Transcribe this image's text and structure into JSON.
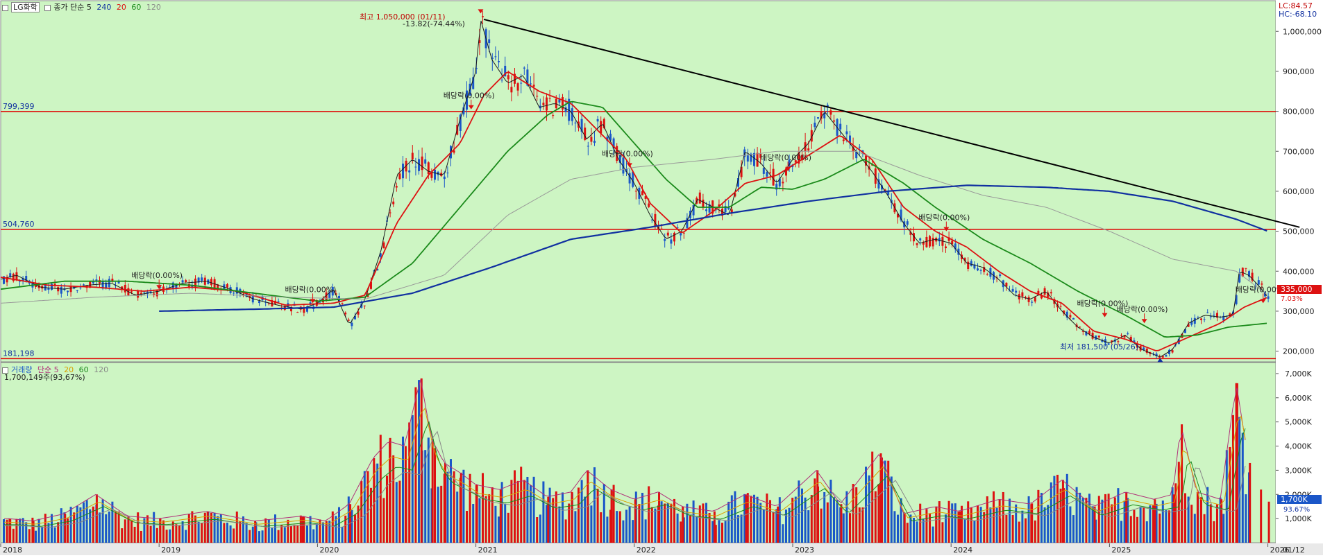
{
  "price_panel": {
    "stock_name": "LG화학",
    "indicator_label": "종가 단순 5",
    "ma_labels": [
      "240",
      "20",
      "60",
      "120"
    ],
    "ma_colors": {
      "ma5": "#1a1a1a",
      "ma20": "#dd1111",
      "ma60": "#1a8a1a",
      "ma120": "#999999",
      "ma240": "#1030a0"
    },
    "lc": "LC:84.57",
    "hc": "HC:-68.10",
    "high_label": "최고 1,050,000 (01/11)",
    "high_change": "-13.82(-74.44%)",
    "low_label": "최저 181,500 (05/26)",
    "last_price": "335,000",
    "last_pct": "7.03%",
    "h_lines": [
      {
        "label": "799,399",
        "value": 799399
      },
      {
        "label": "504,760",
        "value": 504760
      },
      {
        "label": "181,198",
        "value": 181198
      }
    ],
    "dividend_label": "배당락(0.00%)",
    "dividends": [
      {
        "date": 2019.0,
        "value": 355000
      },
      {
        "date": 2019.97,
        "value": 320000
      },
      {
        "date": 2020.97,
        "value": 805000
      },
      {
        "date": 2021.97,
        "value": 660000
      },
      {
        "date": 2022.97,
        "value": 650000
      },
      {
        "date": 2023.97,
        "value": 500000
      },
      {
        "date": 2024.97,
        "value": 285000
      },
      {
        "date": 2025.22,
        "value": 270000
      },
      {
        "date": 2025.97,
        "value": 320000
      }
    ],
    "trendline": {
      "start": {
        "date": 2021.05,
        "value": 1030000
      },
      "end": {
        "date": 2026.2,
        "value": 510000
      }
    },
    "y_ticks": [
      {
        "label": "1,000,000",
        "value": 1000000
      },
      {
        "label": "900,000",
        "value": 900000
      },
      {
        "label": "800,000",
        "value": 800000
      },
      {
        "label": "700,000",
        "value": 700000
      },
      {
        "label": "600,000",
        "value": 600000
      },
      {
        "label": "500,000",
        "value": 500000
      },
      {
        "label": "400,000",
        "value": 400000
      },
      {
        "label": "300,000",
        "value": 300000
      },
      {
        "label": "200,000",
        "value": 200000
      }
    ]
  },
  "volume_panel": {
    "label": "거래량",
    "indicator_label": "단순 5",
    "ma_labels": [
      "20",
      "60",
      "120"
    ],
    "last_volume": "1,700,149주(93,67%)",
    "last_tag": "1,700K",
    "last_pct": "93.67%",
    "y_ticks": [
      {
        "label": "7,000K",
        "value": 7000
      },
      {
        "label": "6,000K",
        "value": 6000
      },
      {
        "label": "5,000K",
        "value": 5000
      },
      {
        "label": "4,000K",
        "value": 4000
      },
      {
        "label": "3,000K",
        "value": 3000
      },
      {
        "label": "2,000K",
        "value": 2000
      },
      {
        "label": "1,000K",
        "value": 1000
      }
    ]
  },
  "x_axis": {
    "labels": [
      {
        "label": "2018",
        "date": 2018.0
      },
      {
        "label": "2019",
        "date": 2019.0
      },
      {
        "label": "2020",
        "date": 2020.0
      },
      {
        "label": "2021",
        "date": 2021.0
      },
      {
        "label": "2022",
        "date": 2022.0
      },
      {
        "label": "2023",
        "date": 2023.0
      },
      {
        "label": "2024",
        "date": 2024.0
      },
      {
        "label": "2025",
        "date": 2025.0
      },
      {
        "label": "2026",
        "date": 2026.0
      }
    ],
    "end_label": "01/12"
  },
  "chart_data": {
    "type": "line",
    "title": "LG화학",
    "x_range": [
      2018.0,
      2026.05
    ],
    "price_range": [
      175000,
      1075000
    ],
    "volume_range_k": [
      0,
      7400
    ],
    "price_series": [
      {
        "name": "종가",
        "points": [
          [
            2018.0,
            380000
          ],
          [
            2018.1,
            390000
          ],
          [
            2018.25,
            360000
          ],
          [
            2018.4,
            355000
          ],
          [
            2018.55,
            365000
          ],
          [
            2018.7,
            370000
          ],
          [
            2018.85,
            340000
          ],
          [
            2019.0,
            350000
          ],
          [
            2019.15,
            370000
          ],
          [
            2019.3,
            375000
          ],
          [
            2019.45,
            355000
          ],
          [
            2019.6,
            330000
          ],
          [
            2019.75,
            315000
          ],
          [
            2019.9,
            305000
          ],
          [
            2020.0,
            320000
          ],
          [
            2020.1,
            355000
          ],
          [
            2020.2,
            265000
          ],
          [
            2020.3,
            330000
          ],
          [
            2020.4,
            450000
          ],
          [
            2020.5,
            640000
          ],
          [
            2020.6,
            680000
          ],
          [
            2020.7,
            650000
          ],
          [
            2020.8,
            640000
          ],
          [
            2020.9,
            780000
          ],
          [
            2021.0,
            900000
          ],
          [
            2021.03,
            1030000
          ],
          [
            2021.1,
            930000
          ],
          [
            2021.2,
            870000
          ],
          [
            2021.3,
            890000
          ],
          [
            2021.4,
            810000
          ],
          [
            2021.5,
            820000
          ],
          [
            2021.6,
            800000
          ],
          [
            2021.7,
            730000
          ],
          [
            2021.8,
            770000
          ],
          [
            2021.9,
            680000
          ],
          [
            2022.0,
            620000
          ],
          [
            2022.1,
            540000
          ],
          [
            2022.2,
            480000
          ],
          [
            2022.3,
            500000
          ],
          [
            2022.4,
            580000
          ],
          [
            2022.5,
            560000
          ],
          [
            2022.6,
            540000
          ],
          [
            2022.7,
            700000
          ],
          [
            2022.8,
            670000
          ],
          [
            2022.9,
            620000
          ],
          [
            2023.0,
            680000
          ],
          [
            2023.1,
            720000
          ],
          [
            2023.2,
            800000
          ],
          [
            2023.3,
            750000
          ],
          [
            2023.4,
            700000
          ],
          [
            2023.5,
            650000
          ],
          [
            2023.6,
            590000
          ],
          [
            2023.7,
            520000
          ],
          [
            2023.8,
            470000
          ],
          [
            2023.9,
            480000
          ],
          [
            2024.0,
            470000
          ],
          [
            2024.1,
            420000
          ],
          [
            2024.2,
            410000
          ],
          [
            2024.3,
            380000
          ],
          [
            2024.4,
            340000
          ],
          [
            2024.5,
            330000
          ],
          [
            2024.6,
            350000
          ],
          [
            2024.7,
            300000
          ],
          [
            2024.8,
            260000
          ],
          [
            2024.9,
            235000
          ],
          [
            2025.0,
            220000
          ],
          [
            2025.1,
            240000
          ],
          [
            2025.2,
            205000
          ],
          [
            2025.32,
            185000
          ],
          [
            2025.4,
            205000
          ],
          [
            2025.5,
            270000
          ],
          [
            2025.6,
            290000
          ],
          [
            2025.7,
            285000
          ],
          [
            2025.78,
            290000
          ],
          [
            2025.82,
            400000
          ],
          [
            2025.88,
            390000
          ],
          [
            2025.95,
            360000
          ],
          [
            2026.0,
            335000
          ]
        ]
      },
      {
        "name": "20",
        "points": [
          [
            2018.0,
            385000
          ],
          [
            2018.3,
            365000
          ],
          [
            2018.6,
            360000
          ],
          [
            2018.9,
            350000
          ],
          [
            2019.2,
            360000
          ],
          [
            2019.5,
            350000
          ],
          [
            2019.8,
            315000
          ],
          [
            2020.1,
            320000
          ],
          [
            2020.3,
            340000
          ],
          [
            2020.5,
            520000
          ],
          [
            2020.7,
            640000
          ],
          [
            2020.9,
            720000
          ],
          [
            2021.05,
            840000
          ],
          [
            2021.2,
            900000
          ],
          [
            2021.4,
            850000
          ],
          [
            2021.6,
            820000
          ],
          [
            2021.8,
            740000
          ],
          [
            2021.95,
            680000
          ],
          [
            2022.1,
            570000
          ],
          [
            2022.3,
            495000
          ],
          [
            2022.5,
            550000
          ],
          [
            2022.7,
            620000
          ],
          [
            2022.9,
            640000
          ],
          [
            2023.1,
            690000
          ],
          [
            2023.3,
            740000
          ],
          [
            2023.5,
            680000
          ],
          [
            2023.7,
            560000
          ],
          [
            2023.9,
            500000
          ],
          [
            2024.1,
            460000
          ],
          [
            2024.3,
            400000
          ],
          [
            2024.5,
            350000
          ],
          [
            2024.7,
            320000
          ],
          [
            2024.9,
            250000
          ],
          [
            2025.1,
            230000
          ],
          [
            2025.3,
            200000
          ],
          [
            2025.5,
            235000
          ],
          [
            2025.7,
            270000
          ],
          [
            2025.85,
            310000
          ],
          [
            2026.0,
            335000
          ]
        ]
      },
      {
        "name": "60",
        "points": [
          [
            2018.0,
            355000
          ],
          [
            2018.4,
            375000
          ],
          [
            2018.8,
            375000
          ],
          [
            2019.2,
            365000
          ],
          [
            2019.6,
            345000
          ],
          [
            2020.0,
            325000
          ],
          [
            2020.3,
            335000
          ],
          [
            2020.6,
            420000
          ],
          [
            2020.9,
            560000
          ],
          [
            2021.2,
            700000
          ],
          [
            2021.45,
            790000
          ],
          [
            2021.6,
            825000
          ],
          [
            2021.8,
            810000
          ],
          [
            2022.0,
            720000
          ],
          [
            2022.2,
            630000
          ],
          [
            2022.4,
            560000
          ],
          [
            2022.6,
            560000
          ],
          [
            2022.8,
            610000
          ],
          [
            2023.0,
            605000
          ],
          [
            2023.2,
            630000
          ],
          [
            2023.45,
            680000
          ],
          [
            2023.7,
            620000
          ],
          [
            2023.9,
            560000
          ],
          [
            2024.2,
            480000
          ],
          [
            2024.5,
            420000
          ],
          [
            2024.8,
            350000
          ],
          [
            2025.1,
            290000
          ],
          [
            2025.35,
            235000
          ],
          [
            2025.55,
            240000
          ],
          [
            2025.75,
            260000
          ],
          [
            2026.0,
            270000
          ]
        ]
      },
      {
        "name": "120",
        "points": [
          [
            2018.0,
            320000
          ],
          [
            2018.6,
            335000
          ],
          [
            2019.2,
            345000
          ],
          [
            2019.8,
            335000
          ],
          [
            2020.3,
            330000
          ],
          [
            2020.8,
            390000
          ],
          [
            2021.2,
            540000
          ],
          [
            2021.6,
            630000
          ],
          [
            2022.0,
            660000
          ],
          [
            2022.5,
            680000
          ],
          [
            2022.9,
            700000
          ],
          [
            2023.4,
            700000
          ],
          [
            2023.8,
            640000
          ],
          [
            2024.2,
            590000
          ],
          [
            2024.6,
            560000
          ],
          [
            2025.0,
            500000
          ],
          [
            2025.4,
            430000
          ],
          [
            2025.8,
            400000
          ],
          [
            2026.0,
            340000
          ]
        ]
      },
      {
        "name": "240",
        "points": [
          [
            2019.0,
            300000
          ],
          [
            2019.6,
            305000
          ],
          [
            2020.1,
            310000
          ],
          [
            2020.6,
            345000
          ],
          [
            2021.1,
            410000
          ],
          [
            2021.6,
            480000
          ],
          [
            2022.1,
            510000
          ],
          [
            2022.6,
            545000
          ],
          [
            2023.1,
            575000
          ],
          [
            2023.6,
            600000
          ],
          [
            2024.1,
            615000
          ],
          [
            2024.6,
            610000
          ],
          [
            2025.0,
            600000
          ],
          [
            2025.4,
            575000
          ],
          [
            2025.8,
            530000
          ],
          [
            2026.0,
            500000
          ]
        ]
      }
    ],
    "volume_k": [
      [
        2018.05,
        1000
      ],
      [
        2018.2,
        900
      ],
      [
        2018.4,
        1200
      ],
      [
        2018.6,
        2000
      ],
      [
        2018.8,
        1100
      ],
      [
        2019.0,
        1000
      ],
      [
        2019.3,
        1300
      ],
      [
        2019.6,
        900
      ],
      [
        2019.9,
        1100
      ],
      [
        2020.05,
        900
      ],
      [
        2020.2,
        1600
      ],
      [
        2020.35,
        3500
      ],
      [
        2020.45,
        4200
      ],
      [
        2020.55,
        4000
      ],
      [
        2020.65,
        6800
      ],
      [
        2020.72,
        4300
      ],
      [
        2020.8,
        3300
      ],
      [
        2020.9,
        2900
      ],
      [
        2021.0,
        2400
      ],
      [
        2021.15,
        2200
      ],
      [
        2021.3,
        2600
      ],
      [
        2021.45,
        1900
      ],
      [
        2021.6,
        2100
      ],
      [
        2021.7,
        3000
      ],
      [
        2021.85,
        2200
      ],
      [
        2022.0,
        1800
      ],
      [
        2022.15,
        2100
      ],
      [
        2022.3,
        1500
      ],
      [
        2022.5,
        1300
      ],
      [
        2022.7,
        2000
      ],
      [
        2022.9,
        1500
      ],
      [
        2023.15,
        3000
      ],
      [
        2023.3,
        1600
      ],
      [
        2023.55,
        3700
      ],
      [
        2023.7,
        1200
      ],
      [
        2023.9,
        1500
      ],
      [
        2024.05,
        1300
      ],
      [
        2024.3,
        1800
      ],
      [
        2024.5,
        1600
      ],
      [
        2024.7,
        2600
      ],
      [
        2024.9,
        1500
      ],
      [
        2025.1,
        2100
      ],
      [
        2025.28,
        1800
      ],
      [
        2025.4,
        2000
      ],
      [
        2025.45,
        4900
      ],
      [
        2025.55,
        2100
      ],
      [
        2025.7,
        1800
      ],
      [
        2025.8,
        6600
      ],
      [
        2025.88,
        3300
      ],
      [
        2025.95,
        2200
      ],
      [
        2026.0,
        1700
      ]
    ]
  }
}
